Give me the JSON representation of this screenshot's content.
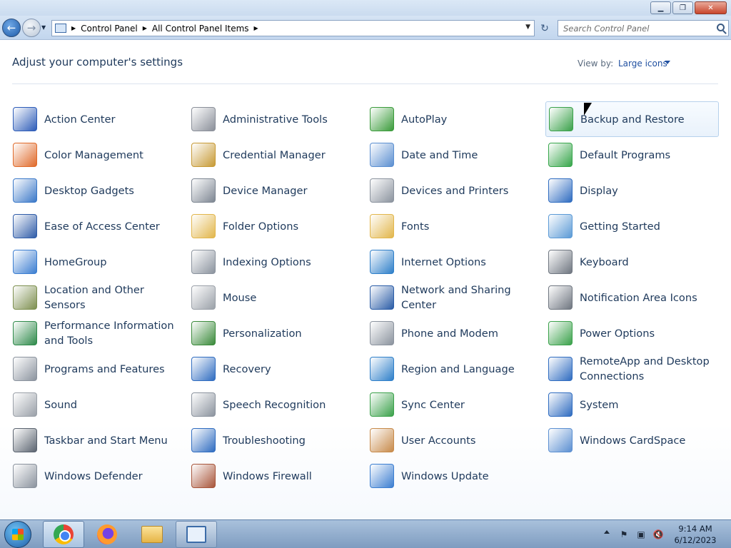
{
  "window": {
    "minimize_label": "▁",
    "restore_label": "❐",
    "close_label": "✕"
  },
  "nav": {
    "back_glyph": "←",
    "forward_glyph": "→",
    "history_glyph": "▼",
    "breadcrumbs": [
      "Control Panel",
      "All Control Panel Items"
    ],
    "crumb_separator": "▶",
    "dropdown_glyph": "▼",
    "refresh_glyph": "↻",
    "search_placeholder": "Search Control Panel"
  },
  "header": {
    "title": "Adjust your computer's settings",
    "view_by_label": "View by:",
    "view_by_value": "Large icons"
  },
  "items": [
    {
      "label": "Action Center",
      "icon": "flag-icon",
      "color": "#2d5cb8"
    },
    {
      "label": "Administrative Tools",
      "icon": "admin-tools-icon",
      "color": "#8a8f99"
    },
    {
      "label": "AutoPlay",
      "icon": "autoplay-icon",
      "color": "#3a9b3a"
    },
    {
      "label": "Backup and Restore",
      "icon": "backup-icon",
      "color": "#3aa14a"
    },
    {
      "label": "Color Management",
      "icon": "color-management-icon",
      "color": "#e06a2a"
    },
    {
      "label": "Credential Manager",
      "icon": "vault-icon",
      "color": "#c79a35"
    },
    {
      "label": "Date and Time",
      "icon": "calendar-clock-icon",
      "color": "#5b8fd1"
    },
    {
      "label": "Default Programs",
      "icon": "default-programs-icon",
      "color": "#37a64b"
    },
    {
      "label": "Desktop Gadgets",
      "icon": "gadgets-icon",
      "color": "#3a78c8"
    },
    {
      "label": "Device Manager",
      "icon": "device-manager-icon",
      "color": "#7d8692"
    },
    {
      "label": "Devices and Printers",
      "icon": "printer-icon",
      "color": "#8b939e"
    },
    {
      "label": "Display",
      "icon": "monitor-icon",
      "color": "#2f6cc0"
    },
    {
      "label": "Ease of Access Center",
      "icon": "ease-of-access-icon",
      "color": "#2f5ca8"
    },
    {
      "label": "Folder Options",
      "icon": "folder-icon",
      "color": "#e2b64b"
    },
    {
      "label": "Fonts",
      "icon": "fonts-icon",
      "color": "#e2b64b"
    },
    {
      "label": "Getting Started",
      "icon": "getting-started-icon",
      "color": "#5b9ad6"
    },
    {
      "label": "HomeGroup",
      "icon": "homegroup-icon",
      "color": "#3b7ed1"
    },
    {
      "label": "Indexing Options",
      "icon": "indexing-icon",
      "color": "#8b939e"
    },
    {
      "label": "Internet Options",
      "icon": "internet-icon",
      "color": "#2e7fc9"
    },
    {
      "label": "Keyboard",
      "icon": "keyboard-icon",
      "color": "#6f7680"
    },
    {
      "label": "Location and Other Sensors",
      "icon": "sensor-icon",
      "color": "#7d8f4f"
    },
    {
      "label": "Mouse",
      "icon": "mouse-icon",
      "color": "#9aa0a8"
    },
    {
      "label": "Network and Sharing Center",
      "icon": "network-icon",
      "color": "#2a5ca6"
    },
    {
      "label": "Notification Area Icons",
      "icon": "notification-icon",
      "color": "#6f7680"
    },
    {
      "label": "Performance Information and Tools",
      "icon": "performance-icon",
      "color": "#2e8a4a"
    },
    {
      "label": "Personalization",
      "icon": "personalization-icon",
      "color": "#3a8a3a"
    },
    {
      "label": "Phone and Modem",
      "icon": "phone-icon",
      "color": "#8b939e"
    },
    {
      "label": "Power Options",
      "icon": "power-icon",
      "color": "#3aa14a"
    },
    {
      "label": "Programs and Features",
      "icon": "programs-icon",
      "color": "#8b939e"
    },
    {
      "label": "Recovery",
      "icon": "recovery-icon",
      "color": "#2f6cc0"
    },
    {
      "label": "Region and Language",
      "icon": "globe-icon",
      "color": "#2e7fc9"
    },
    {
      "label": "RemoteApp and Desktop Connections",
      "icon": "remote-icon",
      "color": "#2f6cc0"
    },
    {
      "label": "Sound",
      "icon": "speaker-icon",
      "color": "#9aa0a8"
    },
    {
      "label": "Speech Recognition",
      "icon": "microphone-icon",
      "color": "#8b939e"
    },
    {
      "label": "Sync Center",
      "icon": "sync-icon",
      "color": "#3aa14a"
    },
    {
      "label": "System",
      "icon": "system-icon",
      "color": "#2f6cc0"
    },
    {
      "label": "Taskbar and Start Menu",
      "icon": "taskbar-icon",
      "color": "#5b6470"
    },
    {
      "label": "Troubleshooting",
      "icon": "troubleshooting-icon",
      "color": "#2f6cc0"
    },
    {
      "label": "User Accounts",
      "icon": "users-icon",
      "color": "#c78a4a"
    },
    {
      "label": "Windows CardSpace",
      "icon": "cardspace-icon",
      "color": "#5b8fd1"
    },
    {
      "label": "Windows Defender",
      "icon": "defender-icon",
      "color": "#8b939e"
    },
    {
      "label": "Windows Firewall",
      "icon": "firewall-icon",
      "color": "#a8553a"
    },
    {
      "label": "Windows Update",
      "icon": "windows-update-icon",
      "color": "#3b7ed1"
    }
  ],
  "taskbar": {
    "clock_time": "9:14 AM",
    "clock_date": "6/12/2023"
  }
}
